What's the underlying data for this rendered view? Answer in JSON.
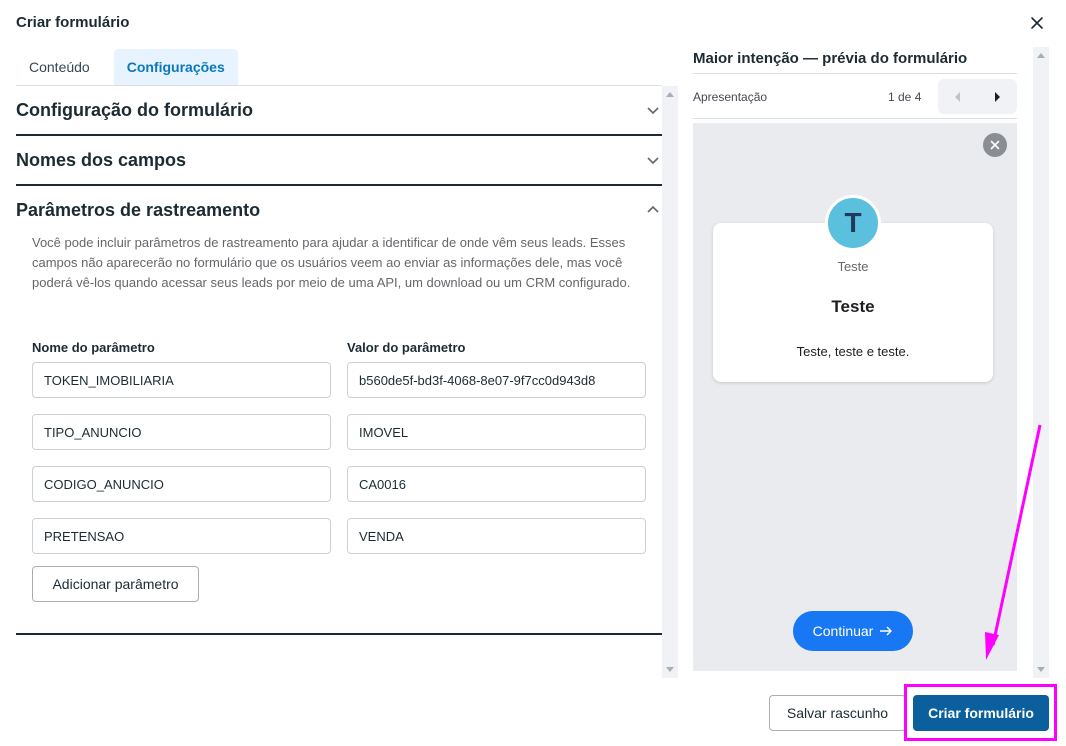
{
  "modal": {
    "title": "Criar formulário"
  },
  "tabs": [
    {
      "label": "Conteúdo",
      "active": false
    },
    {
      "label": "Configurações",
      "active": true
    }
  ],
  "sections": [
    {
      "title": "Configuração do formulário",
      "expanded": false
    },
    {
      "title": "Nomes dos campos",
      "expanded": false
    },
    {
      "title": "Parâmetros de rastreamento",
      "expanded": true
    }
  ],
  "tracking": {
    "description": "Você pode incluir parâmetros de rastreamento para ajudar a identificar de onde vêm seus leads. Esses campos não aparecerão no formulário que os usuários veem ao enviar as informações dele, mas você poderá vê-los quando acessar seus leads por meio de uma API, um download ou um CRM configurado.",
    "name_header": "Nome do parâmetro",
    "value_header": "Valor do parâmetro",
    "params": [
      {
        "name": "TOKEN_IMOBILIARIA",
        "value": "b560de5f-bd3f-4068-8e07-9f7cc0d943d8"
      },
      {
        "name": "TIPO_ANUNCIO",
        "value": "IMOVEL"
      },
      {
        "name": "CODIGO_ANUNCIO",
        "value": "CA0016"
      },
      {
        "name": "PRETENSAO",
        "value": "VENDA"
      }
    ],
    "add_label": "Adicionar parâmetro"
  },
  "preview": {
    "title": "Maior intenção — prévia do formulário",
    "subtitle": "Apresentação",
    "page_indicator": "1 de 4",
    "avatar_letter": "T",
    "page_name": "Teste",
    "heading": "Teste",
    "body": "Teste, teste e teste.",
    "continue_label": "Continuar"
  },
  "footer": {
    "draft_label": "Salvar rascunho",
    "create_label": "Criar formulário"
  },
  "colors": {
    "primary": "#0a5f9c",
    "continue": "#1877f2",
    "highlight": "#ff00ff",
    "avatar": "#5bc0de"
  }
}
